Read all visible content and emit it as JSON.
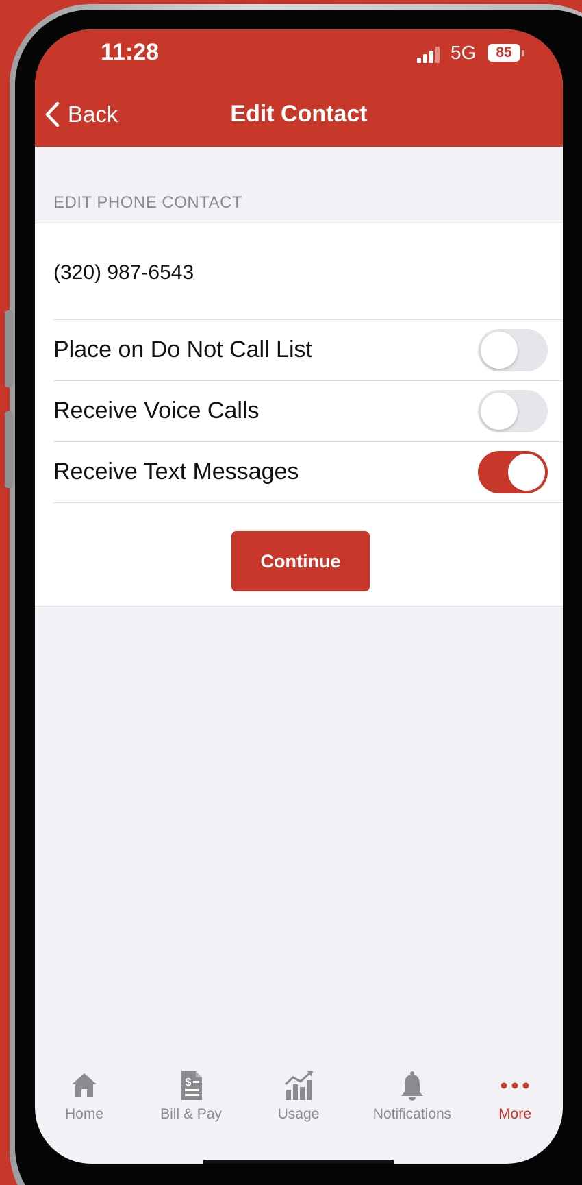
{
  "status_bar": {
    "time": "11:28",
    "network": "5G",
    "battery": "85"
  },
  "nav": {
    "back_label": "Back",
    "title": "Edit Contact"
  },
  "section": {
    "header": "EDIT PHONE CONTACT",
    "phone_number": "(320) 987-6543"
  },
  "settings": [
    {
      "label": "Place on Do Not Call List",
      "enabled": false
    },
    {
      "label": "Receive Voice Calls",
      "enabled": false
    },
    {
      "label": "Receive Text Messages",
      "enabled": true
    }
  ],
  "continue_label": "Continue",
  "tabbar": {
    "items": [
      {
        "label": "Home",
        "icon": "home-icon",
        "active": false
      },
      {
        "label": "Bill & Pay",
        "icon": "bill-icon",
        "active": false
      },
      {
        "label": "Usage",
        "icon": "usage-chart-icon",
        "active": false
      },
      {
        "label": "Notifications",
        "icon": "bell-icon",
        "active": false
      },
      {
        "label": "More",
        "icon": "more-dots-icon",
        "active": true
      }
    ]
  },
  "colors": {
    "brand_red": "#c8382a",
    "background": "#f1f1f6",
    "inactive_gray": "#8a8a8f"
  }
}
